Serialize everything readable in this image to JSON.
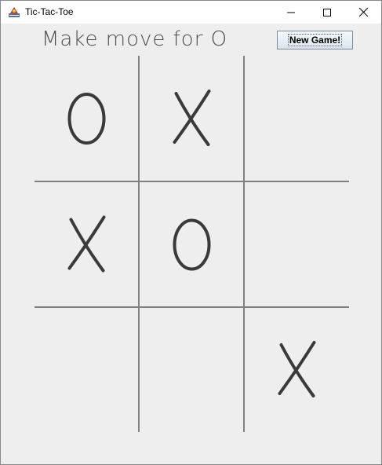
{
  "window": {
    "title": "Tic-Tac-Toe",
    "controls": [
      "minimize",
      "maximize",
      "close"
    ]
  },
  "status": {
    "text": "Make move for O"
  },
  "toolbar": {
    "new_game_label": "New Game!"
  },
  "board": {
    "cells": [
      [
        "O",
        "X",
        ""
      ],
      [
        "X",
        "O",
        ""
      ],
      [
        "",
        "",
        "X"
      ]
    ]
  },
  "colors": {
    "titlebar": "#ffffff",
    "background": "#eeeeee",
    "grid_lines": "#808080",
    "marks": "#3a3a3a"
  }
}
